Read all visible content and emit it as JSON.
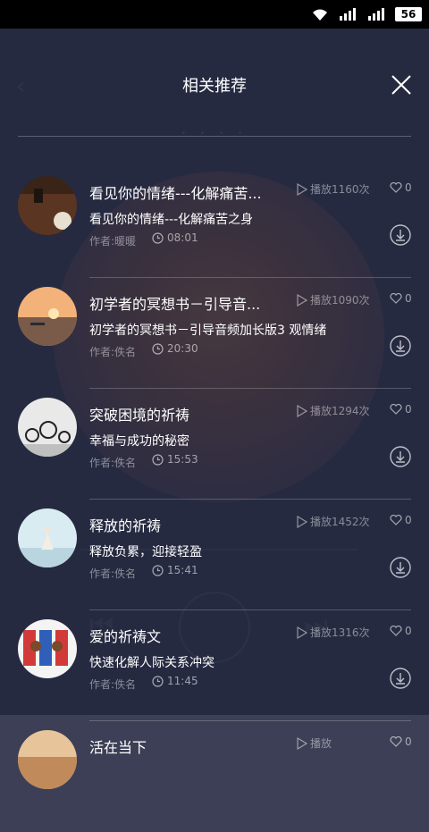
{
  "status_bar": {
    "battery": "56"
  },
  "background": {
    "dots": "• • • •"
  },
  "header": {
    "title": "相关推荐",
    "close_icon": "close-icon"
  },
  "list": [
    {
      "title": "看见你的情绪---化解痛苦...",
      "subtitle": "看见你的情绪---化解痛苦之身",
      "author": "作者:暖暖",
      "duration": "08:01",
      "plays": "播放1160次",
      "likes": "0"
    },
    {
      "title": "初学者的冥想书－引导音...",
      "subtitle": "初学者的冥想书－引导音频加长版3 观情绪",
      "author": "作者:佚名",
      "duration": "20:30",
      "plays": "播放1090次",
      "likes": "0"
    },
    {
      "title": "突破困境的祈祷",
      "subtitle": "幸福与成功的秘密",
      "author": "作者:佚名",
      "duration": "15:53",
      "plays": "播放1294次",
      "likes": "0"
    },
    {
      "title": "释放的祈祷",
      "subtitle": "释放负累，迎接轻盈",
      "author": "作者:佚名",
      "duration": "15:41",
      "plays": "播放1452次",
      "likes": "0"
    },
    {
      "title": "爱的祈祷文",
      "subtitle": "快速化解人际关系冲突",
      "author": "作者:佚名",
      "duration": "11:45",
      "plays": "播放1316次",
      "likes": "0"
    },
    {
      "title": "活在当下",
      "subtitle": "",
      "author": "",
      "duration": "",
      "plays": "播放",
      "likes": "0"
    }
  ]
}
